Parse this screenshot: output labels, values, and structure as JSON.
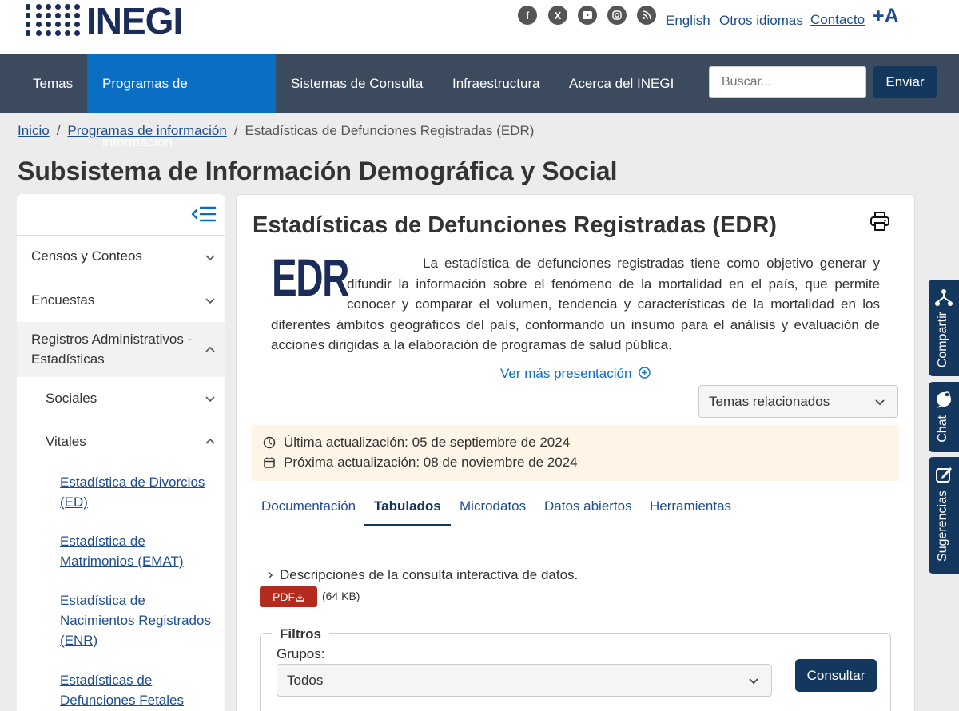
{
  "header": {
    "logo_text": "INEGI",
    "social_icons": [
      "facebook-icon",
      "x-icon",
      "youtube-icon",
      "instagram-icon",
      "rss-icon"
    ],
    "links": {
      "english": "English",
      "otros_idiomas": "Otros idiomas",
      "contacto": "Contacto"
    },
    "font_size_toggle": "+A"
  },
  "nav": {
    "items": [
      {
        "label": "Temas"
      },
      {
        "label": "Programas de información",
        "active": true
      },
      {
        "label": "Sistemas de Consulta"
      },
      {
        "label": "Infraestructura"
      },
      {
        "label": "Acerca del INEGI"
      }
    ],
    "search_placeholder": "Buscar...",
    "search_button": "Enviar"
  },
  "breadcrumb": {
    "inicio": "Inicio",
    "programas": "Programas de información",
    "current": "Estadísticas de Defunciones Registradas (EDR)",
    "separator": "/"
  },
  "page_title": "Subsistema de Información Demográfica y Social",
  "sidebar": {
    "items": {
      "censos": "Censos y Conteos",
      "encuestas": "Encuestas",
      "registros": "Registros Administrativos - Estadísticas",
      "sociales": "Sociales",
      "vitales": "Vitales"
    },
    "links": [
      "Estadística de Divorcios (ED)",
      "Estadística de Matrimonios (EMAT)",
      "Estadística de Nacimientos Registrados (ENR)",
      "Estadísticas de Defunciones Fetales"
    ]
  },
  "main": {
    "title": "Estadísticas de Defunciones Registradas (EDR)",
    "edr_logo": "EDR",
    "intro": "La estadística de defunciones registradas tiene como objetivo generar y difundir la información sobre el fenómeno de la mortalidad en el país, que permite conocer y comparar el volumen, tendencia y características de la mortalidad en los diferentes ámbitos geográficos del país, conformando un insumo para el análisis y evaluación de acciones dirigidas a la elaboración de programas de salud pública.",
    "ver_mas": "Ver más presentación",
    "temas_relacionados": "Temas relacionados",
    "ultima_actualizacion": "Última actualización: 05 de septiembre de 2024",
    "proxima_actualizacion": "Próxima actualización: 08 de noviembre de 2024",
    "tabs": [
      "Documentación",
      "Tabulados",
      "Microdatos",
      "Datos abiertos",
      "Herramientas"
    ],
    "active_tab": "Tabulados",
    "descripcion": "Descripciones de la consulta interactiva de datos.",
    "pdf_label": "PDF",
    "pdf_size": "(64 KB)",
    "filtros": {
      "legend": "Filtros",
      "grupos_label": "Grupos:",
      "grupos_value": "Todos",
      "consultar": "Consultar"
    }
  },
  "float_tabs": {
    "compartir": "Compartir",
    "chat": "Chat",
    "sugerencias": "Sugerencias"
  },
  "colors": {
    "navbar": "#3b4a5c",
    "nav_active": "#0a6fc2",
    "brand_dark": "#14375e",
    "link": "#1f4e8f",
    "pdf": "#b32a1f",
    "update_bg": "#fef5e7"
  }
}
